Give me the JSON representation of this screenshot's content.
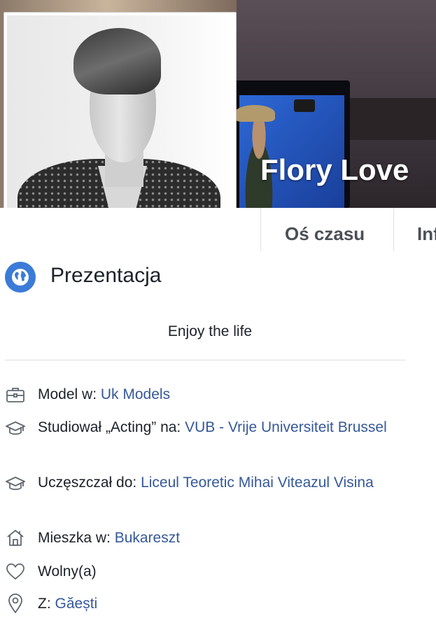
{
  "cover": {
    "name": "Flory Love"
  },
  "tabs": [
    {
      "label": "Oś czasu"
    },
    {
      "label": "Inf"
    }
  ],
  "intro": {
    "title": "Prezentacja",
    "icon": "globe-icon",
    "bio": "Enjoy the life"
  },
  "details": {
    "work": {
      "icon": "briefcase-icon",
      "prefix": "Model w: ",
      "link": "Uk Models"
    },
    "study": {
      "icon": "graduation-cap-icon",
      "prefix": "Studiował „Acting” na: ",
      "link": "VUB - Vrije Universiteit Brussel"
    },
    "school": {
      "icon": "graduation-cap-icon",
      "prefix": "Uczęszczał do: ",
      "link": "Liceul Teoretic Mihai Viteazul Visina"
    },
    "lives": {
      "icon": "house-icon",
      "prefix": "Mieszka w: ",
      "link": "Bukareszt"
    },
    "relationship": {
      "icon": "heart-icon",
      "text": "Wolny(a)"
    },
    "from": {
      "icon": "location-pin-icon",
      "prefix": "Z: ",
      "link": "Găești"
    }
  },
  "colors": {
    "link": "#365899",
    "text": "#1d2129",
    "tab_text": "#4b4f56",
    "globe_icon_bg": "#3b7bd8",
    "divider": "#dddfe2"
  }
}
